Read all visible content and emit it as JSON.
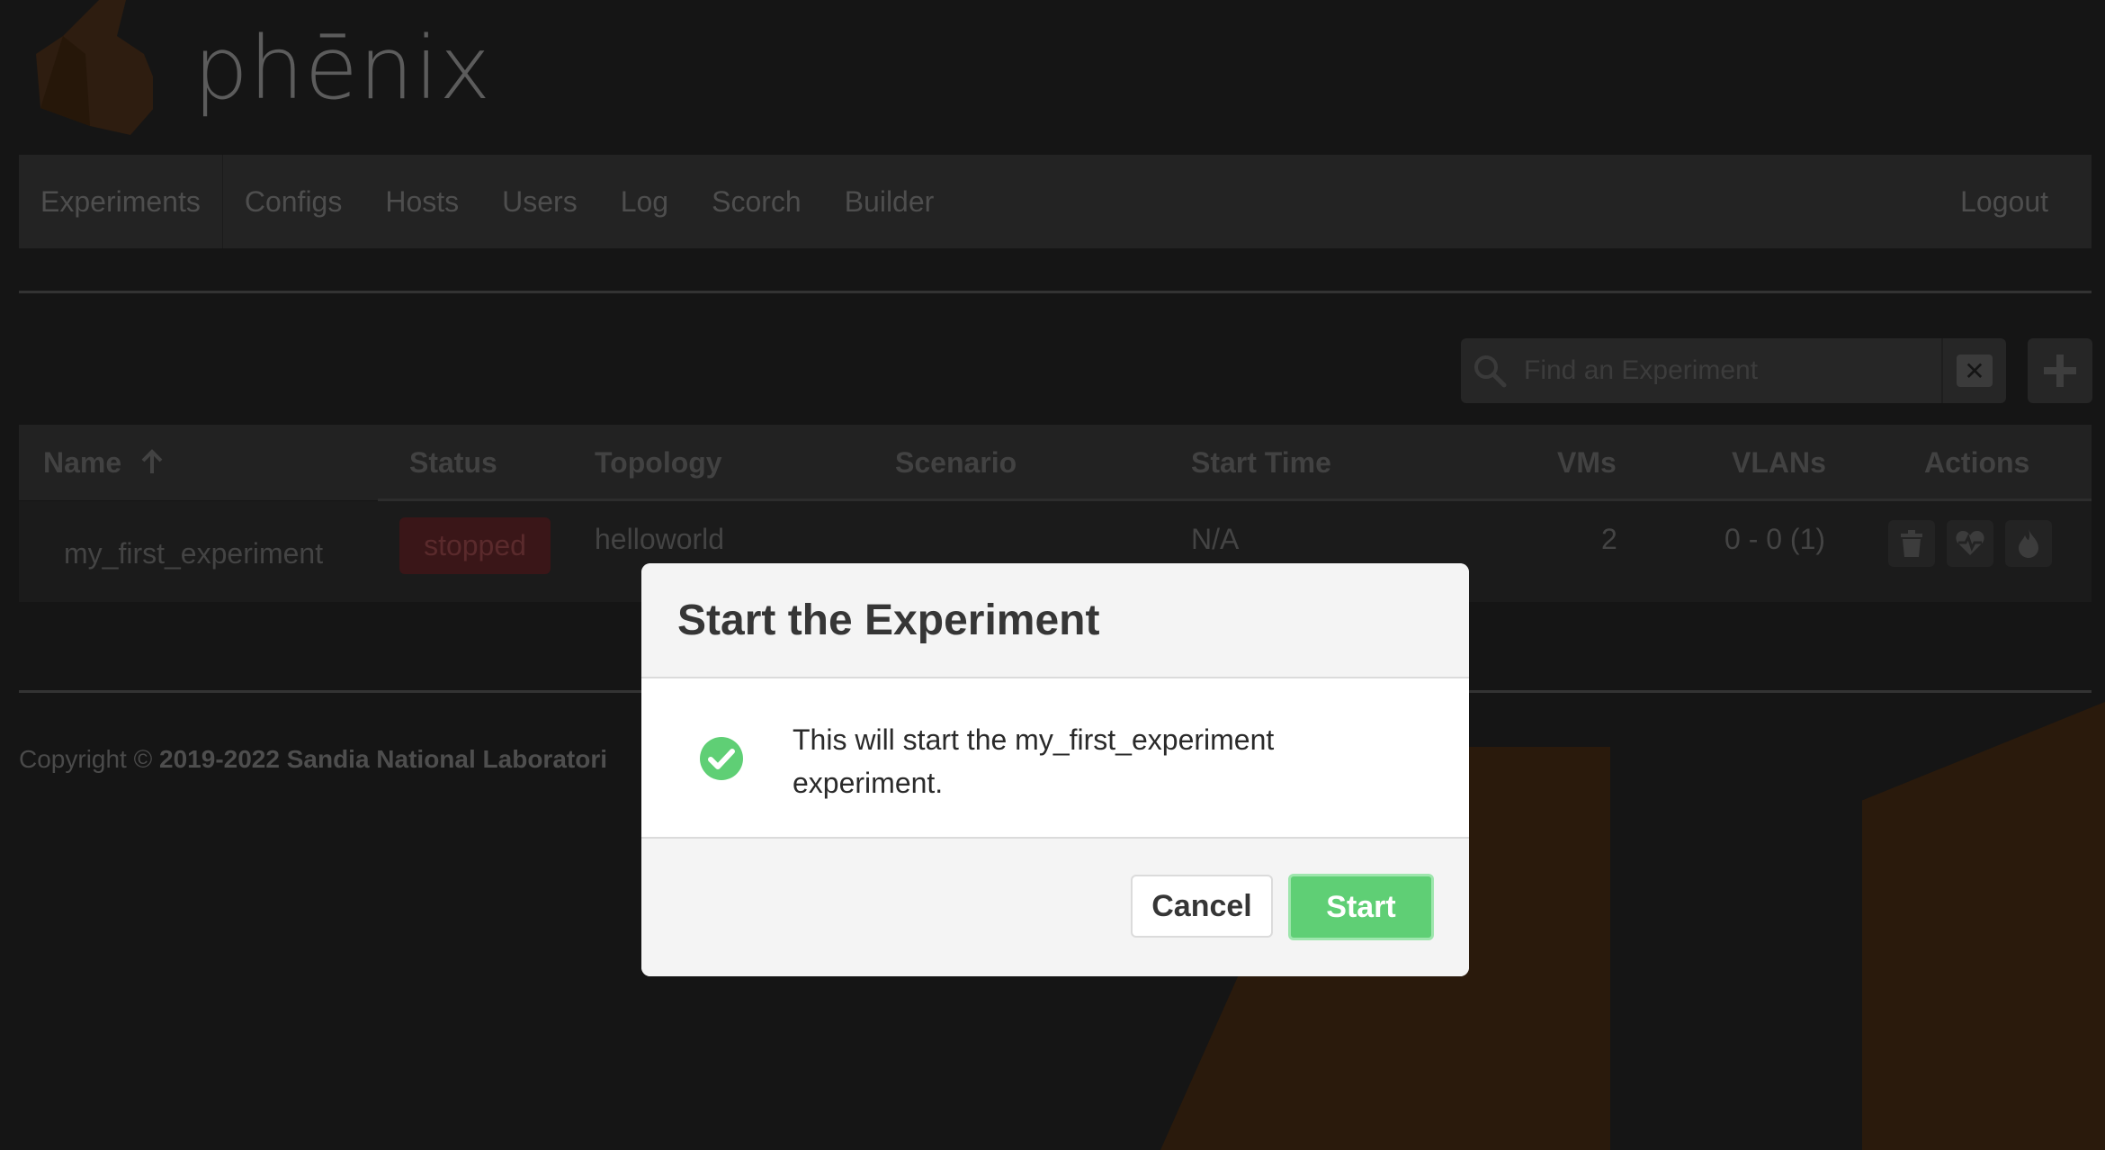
{
  "app": {
    "logo_text": "phēnix"
  },
  "nav": {
    "items": [
      "Experiments",
      "Configs",
      "Hosts",
      "Users",
      "Log",
      "Scorch",
      "Builder"
    ],
    "logout": "Logout"
  },
  "search": {
    "placeholder": "Find an Experiment"
  },
  "table": {
    "headers": {
      "name": "Name",
      "status": "Status",
      "topology": "Topology",
      "scenario": "Scenario",
      "start_time": "Start Time",
      "vms": "VMs",
      "vlans": "VLANs",
      "actions": "Actions"
    },
    "sort": "Name ascending",
    "rows": [
      {
        "name": "my_first_experiment",
        "status": "stopped",
        "topology": "helloworld",
        "scenario": "",
        "start_time": "N/A",
        "vms": "2",
        "vlans": "0 - 0 (1)"
      }
    ]
  },
  "footer": {
    "prefix": "Copyright ©",
    "holder": "2019-2022 Sandia National Laboratori"
  },
  "modal": {
    "title": "Start the Experiment",
    "message_line1": "This will start the my_first_experiment",
    "message_line2": "experiment.",
    "cancel_label": "Cancel",
    "start_label": "Start"
  },
  "colors": {
    "background": "#151515",
    "accent_start": "#5fcf75",
    "status_stopped": "#3a1618"
  },
  "icons": [
    "phenix-logo-icon",
    "search-icon",
    "clear-icon",
    "plus-icon",
    "sort-arrow-up-icon",
    "trash-icon",
    "heartbeat-icon",
    "flame-icon",
    "check-circle-icon"
  ]
}
